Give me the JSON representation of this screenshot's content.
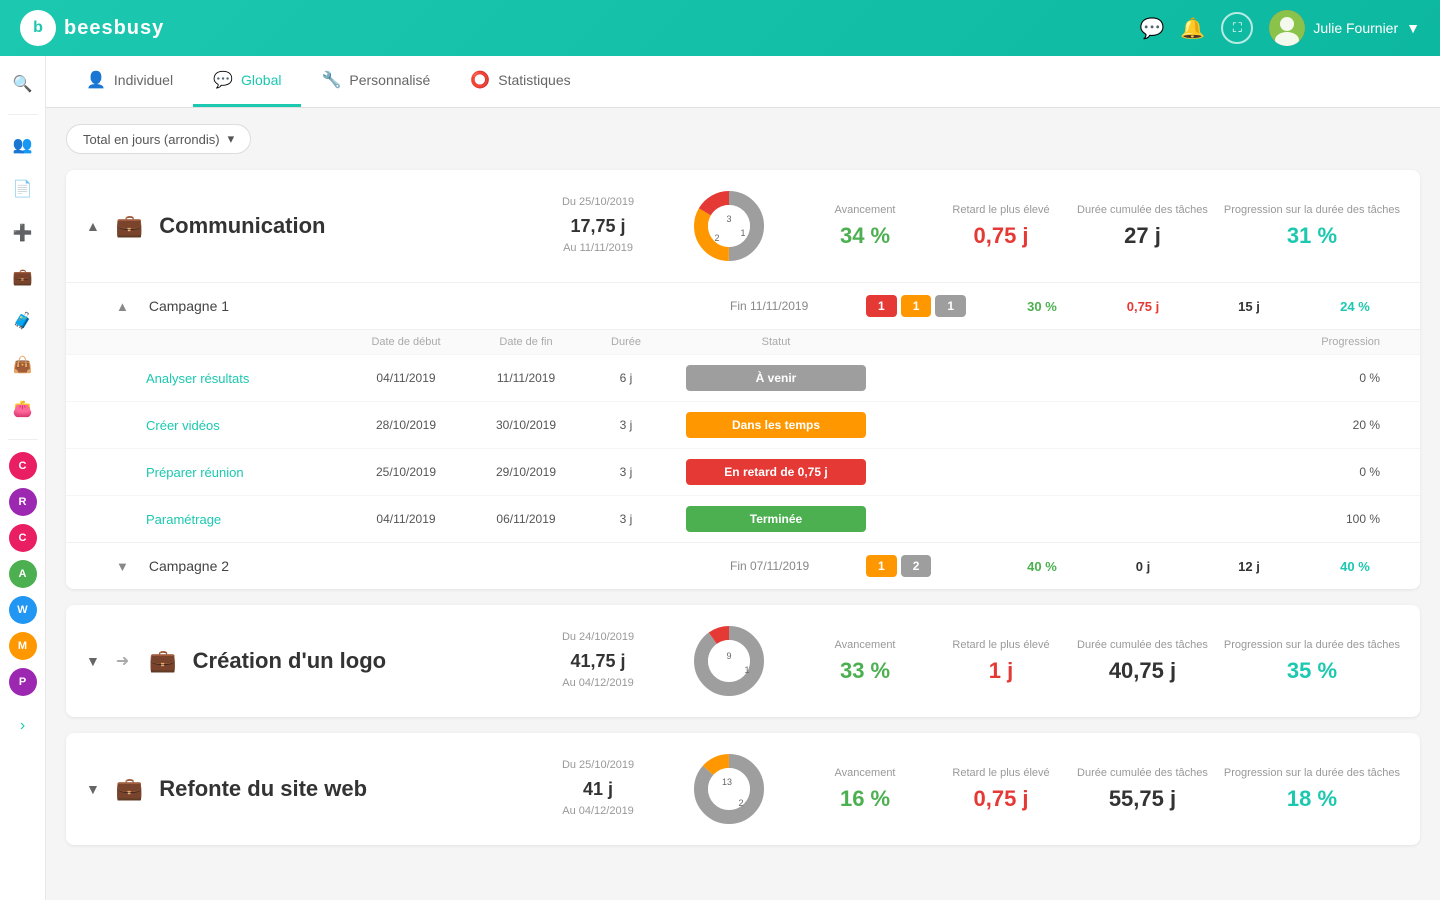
{
  "header": {
    "logo_text": "beesbusy",
    "user_name": "Julie Fournier"
  },
  "tabs": [
    {
      "id": "individuel",
      "label": "Individuel",
      "icon": "👤",
      "active": false
    },
    {
      "id": "global",
      "label": "Global",
      "icon": "💬",
      "active": true
    },
    {
      "id": "personnalise",
      "label": "Personnalisé",
      "icon": "🔧",
      "active": false
    },
    {
      "id": "statistiques",
      "label": "Statistiques",
      "icon": "⭕",
      "active": false
    }
  ],
  "filter_label": "Total en jours (arrondis)",
  "sidebar": {
    "items": [
      {
        "id": "search",
        "icon": "🔍",
        "color": "#ccc"
      },
      {
        "id": "users",
        "icon": "👥",
        "color": "#1cc8b0"
      },
      {
        "id": "doc",
        "icon": "📄",
        "color": "#ccc"
      },
      {
        "id": "add",
        "icon": "➕",
        "color": "#ff9800"
      },
      {
        "id": "bag1",
        "icon": "💼",
        "color": "#ff9800"
      },
      {
        "id": "bag2",
        "icon": "🧳",
        "color": "#1cc8b0"
      },
      {
        "id": "bag3",
        "icon": "👜",
        "color": "#ff9800"
      },
      {
        "id": "bag4",
        "icon": "👛",
        "color": "#e91e63"
      },
      {
        "id": "C",
        "label": "C",
        "color": "#e91e63"
      },
      {
        "id": "R",
        "label": "R",
        "color": "#9c27b0"
      },
      {
        "id": "C2",
        "label": "C",
        "color": "#e91e63"
      },
      {
        "id": "A",
        "label": "A",
        "color": "#4caf50"
      },
      {
        "id": "W",
        "label": "W",
        "color": "#2196f3"
      },
      {
        "id": "M",
        "label": "M",
        "color": "#ff9800"
      },
      {
        "id": "P",
        "label": "P",
        "color": "#9c27b0"
      }
    ]
  },
  "projects": [
    {
      "id": "communication",
      "name": "Communication",
      "icon": "💼",
      "icon_color": "#ff9800",
      "expanded": true,
      "date_from_label": "Du 25/10/2019",
      "duration": "17,75 j",
      "date_to_label": "Au 11/11/2019",
      "avancement_label": "Avancement",
      "avancement": "34 %",
      "retard_label": "Retard le plus élevé",
      "retard": "0,75 j",
      "duree_label": "Durée cumulée des tâches",
      "duree": "27 j",
      "progression_label": "Progression sur la durée des tâches",
      "progression": "31 %",
      "donut": {
        "segments": [
          {
            "label": "3",
            "value": 3,
            "color": "#9e9e9e"
          },
          {
            "label": "2",
            "value": 2,
            "color": "#ff9800"
          },
          {
            "label": "1",
            "value": 1,
            "color": "#e53935"
          }
        ],
        "total": 6
      },
      "campaigns": [
        {
          "id": "campagne1",
          "name": "Campagne 1",
          "expanded": true,
          "date_label": "Fin 11/11/2019",
          "pills": [
            {
              "value": "1",
              "color": "pill-red"
            },
            {
              "value": "1",
              "color": "pill-orange"
            },
            {
              "value": "1",
              "color": "pill-gray"
            }
          ],
          "avancement": "30 %",
          "avancement_color": "green",
          "retard": "0,75 j",
          "retard_color": "red",
          "duree": "15 j",
          "progression": "24 %",
          "progression_color": "teal",
          "tasks": [
            {
              "name": "Analyser résultats",
              "date_debut": "04/11/2019",
              "date_fin": "11/11/2019",
              "duree": "6 j",
              "statut": "À venir",
              "statut_color": "status-gray",
              "progression": "0 %"
            },
            {
              "name": "Créer vidéos",
              "date_debut": "28/10/2019",
              "date_fin": "30/10/2019",
              "duree": "3 j",
              "statut": "Dans les temps",
              "statut_color": "status-orange",
              "progression": "20 %"
            },
            {
              "name": "Préparer réunion",
              "date_debut": "25/10/2019",
              "date_fin": "29/10/2019",
              "duree": "3 j",
              "statut": "En retard de 0,75 j",
              "statut_color": "status-red",
              "progression": "0 %"
            },
            {
              "name": "Paramétrage",
              "date_debut": "04/11/2019",
              "date_fin": "06/11/2019",
              "duree": "3 j",
              "statut": "Terminée",
              "statut_color": "status-green",
              "progression": "100 %"
            }
          ]
        },
        {
          "id": "campagne2",
          "name": "Campagne 2",
          "expanded": false,
          "date_label": "Fin 07/11/2019",
          "pills": [
            {
              "value": "1",
              "color": "pill-orange"
            },
            {
              "value": "2",
              "color": "pill-gray"
            }
          ],
          "avancement": "40 %",
          "avancement_color": "green",
          "retard": "0 j",
          "retard_color": "dark",
          "duree": "12 j",
          "progression": "40 %",
          "progression_color": "teal",
          "tasks": []
        }
      ]
    },
    {
      "id": "creation-logo",
      "name": "Création d'un logo",
      "icon": "💼",
      "icon_color": "#607d8b",
      "linked": true,
      "expanded": false,
      "date_from_label": "Du 24/10/2019",
      "duration": "41,75 j",
      "date_to_label": "Au 04/12/2019",
      "avancement_label": "Avancement",
      "avancement": "33 %",
      "retard_label": "Retard le plus élevé",
      "retard": "1 j",
      "duree_label": "Durée cumulée des tâches",
      "duree": "40,75 j",
      "progression_label": "Progression sur la durée des tâches",
      "progression": "35 %",
      "donut": {
        "segments": [
          {
            "label": "9",
            "value": 9,
            "color": "#9e9e9e"
          },
          {
            "label": "1",
            "value": 1,
            "color": "#e53935"
          }
        ],
        "total": 10
      },
      "campaigns": []
    },
    {
      "id": "refonte-site",
      "name": "Refonte du site web",
      "icon": "💼",
      "icon_color": "#4caf50",
      "expanded": false,
      "date_from_label": "Du 25/10/2019",
      "duration": "41 j",
      "date_to_label": "Au 04/12/2019",
      "avancement_label": "Avancement",
      "avancement": "16 %",
      "retard_label": "Retard le plus élevé",
      "retard": "0,75 j",
      "duree_label": "Durée cumulée des tâches",
      "duree": "55,75 j",
      "progression_label": "Progression sur la durée des tâches",
      "progression": "18 %",
      "donut": {
        "segments": [
          {
            "label": "13",
            "value": 13,
            "color": "#9e9e9e"
          },
          {
            "label": "2",
            "value": 2,
            "color": "#ff9800"
          }
        ],
        "total": 15
      },
      "campaigns": []
    }
  ],
  "task_headers": {
    "date_debut": "Date de début",
    "date_fin": "Date de fin",
    "duree": "Durée",
    "statut": "Statut",
    "progression": "Progression"
  }
}
